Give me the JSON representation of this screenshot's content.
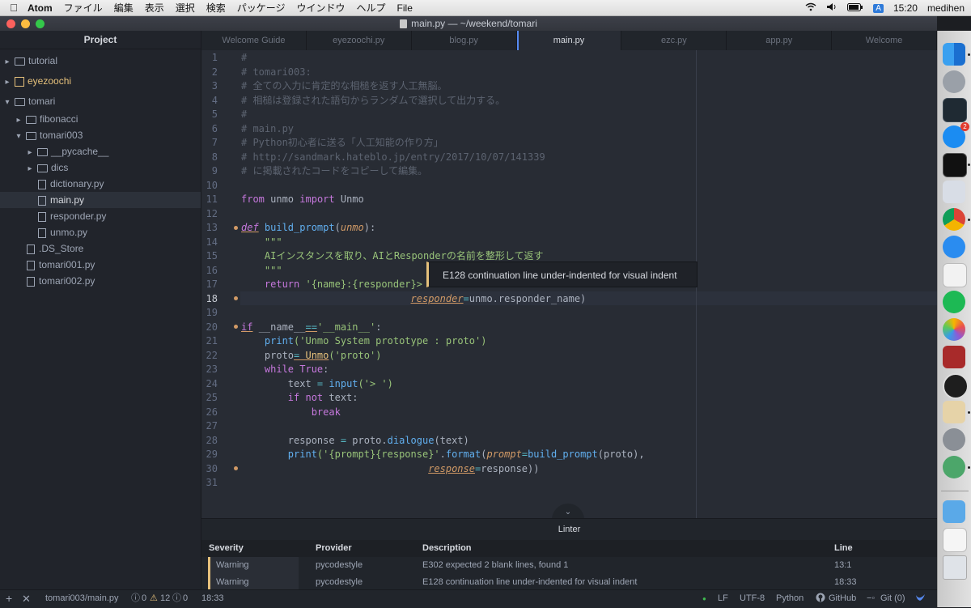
{
  "menubar": {
    "app": "Atom",
    "items": [
      "ファイル",
      "編集",
      "表示",
      "選択",
      "検索",
      "パッケージ",
      "ウインドウ",
      "ヘルプ",
      "File"
    ],
    "ime": "A",
    "clock": "15:20",
    "user": "medihen"
  },
  "window": {
    "title": "main.py — ~/weekend/tomari"
  },
  "tree": {
    "title": "Project",
    "rows": [
      "tutorial",
      "eyezoochi",
      "tomari",
      "fibonacci",
      "tomari003",
      "__pycache__",
      "dics",
      "dictionary.py",
      "main.py",
      "responder.py",
      "unmo.py",
      ".DS_Store",
      "tomari001.py",
      "tomari002.py"
    ]
  },
  "tabs": [
    "Welcome Guide",
    "eyezoochi.py",
    "blog.py",
    "main.py",
    "ezc.py",
    "app.py",
    "Welcome"
  ],
  "editor": {
    "lines": [
      "1",
      "2",
      "3",
      "4",
      "5",
      "6",
      "7",
      "8",
      "9",
      "10",
      "11",
      "12",
      "13",
      "14",
      "15",
      "16",
      "17",
      "18",
      "19",
      "20",
      "21",
      "22",
      "23",
      "24",
      "25",
      "26",
      "27",
      "28",
      "29",
      "30",
      "31"
    ],
    "code": {
      "l1": "#",
      "l2": "# tomari003:",
      "l3": "# 全ての入力に肯定的な相槌を返す人工無脳。",
      "l4": "# 相槌は登録された語句からランダムで選択して出力する。",
      "l5": "#",
      "l6": "# main.py",
      "l7": "# Python初心者に送る「人工知能の作り方」",
      "l8": "# http://sandmark.hateblo.jp/entry/2017/10/07/141339",
      "l9": "# に掲載されたコードをコピーして編集。",
      "l11_from": "from",
      "l11_mod": " unmo ",
      "l11_import": "import",
      "l11_name": " Unmo",
      "l13_def": "def",
      "l13_fn": " build_prompt",
      "l13_open": "(",
      "l13_param": "unmo",
      "l13_close": "):",
      "l14": "    \"\"\"",
      "l15": "    AIインスタンスを取り、AIとResponderの名前を整形して返す",
      "l16": "    \"\"\"",
      "l17_ret": "    return",
      "l17_str": " '{name}:{responder}>",
      "l18_pad": "                             ",
      "l18_kw": "responder",
      "l18_eq": "=",
      "l18_rest": "unmo.responder_name)",
      "l20_if": "if",
      "l20_sp": " ",
      "l20_name": "__name__",
      "l20_eq": "==",
      "l20_main": "'__main__'",
      "l20_colon": ":",
      "l21_fn": "    print",
      "l21_str": "('Unmo System prototype : proto')",
      "l22_var": "    proto",
      "l22_eq": "= ",
      "l22_cls": "Unmo",
      "l22_str": "('proto')",
      "l23_kw": "    while",
      "l23_true": " True",
      "l23_colon": ":",
      "l24_var": "        text",
      "l24_eq": " = ",
      "l24_fn": "input",
      "l24_str": "('> ')",
      "l25_if": "        if",
      "l25_not": " not",
      "l25_rest": " text:",
      "l26": "            break",
      "l28_var": "        response",
      "l28_eq": " = ",
      "l28_obj": "proto.",
      "l28_fn": "dialogue",
      "l28_rest": "(text)",
      "l29_fn": "        print",
      "l29_str": "('{prompt}{response}'",
      "l29_dot": ".",
      "l29_fmt": "format",
      "l29_open": "(",
      "l29_kw": "prompt",
      "l29_eq": "=",
      "l29_fn2": "build_prompt",
      "l29_rest": "(proto),",
      "l30_pad": "                                ",
      "l30_kw": "response",
      "l30_eq": "=",
      "l30_rest": "response))"
    },
    "tooltip": "E128 continuation line under-indented for visual indent"
  },
  "linter": {
    "title": "Linter",
    "headers": {
      "severity": "Severity",
      "provider": "Provider",
      "description": "Description",
      "line": "Line"
    },
    "rows": [
      {
        "severity": "Warning",
        "provider": "pycodestyle",
        "description": "E302 expected 2 blank lines, found 1",
        "line": "13:1"
      },
      {
        "severity": "Warning",
        "provider": "pycodestyle",
        "description": "E128 continuation line under-indented for visual indent",
        "line": "18:33"
      }
    ]
  },
  "status": {
    "path": "tomari003/main.py",
    "errors": "0",
    "warnings": "12",
    "infos": "0",
    "cursor": "18:33",
    "eol": "LF",
    "encoding": "UTF-8",
    "grammar": "Python",
    "github": "GitHub",
    "git": "Git (0)"
  },
  "dock": {
    "badge": "2"
  },
  "colors": {
    "warning": "#e5c07b",
    "accent": "#568af2",
    "background": "#282c34"
  }
}
